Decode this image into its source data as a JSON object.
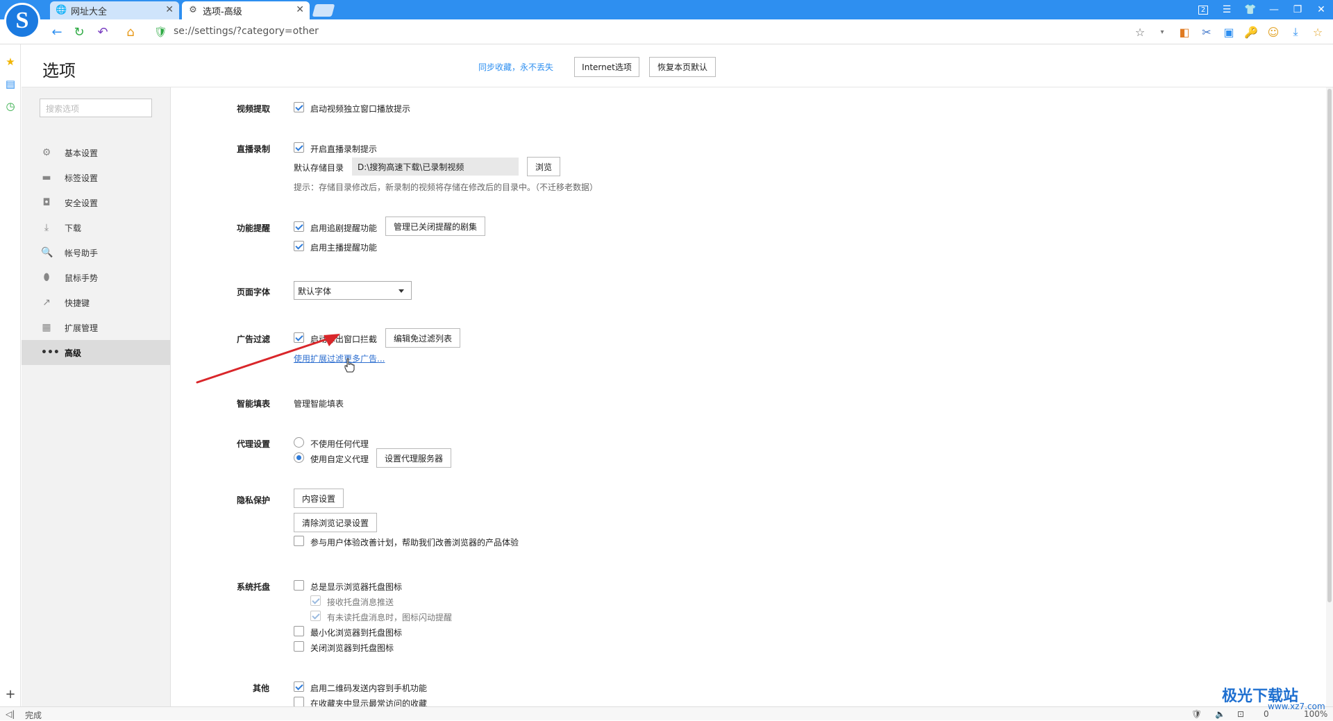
{
  "browser": {
    "tabs": [
      {
        "label": "网址大全",
        "icon": "globe-icon"
      },
      {
        "label": "选项-高级",
        "icon": "gear-icon"
      }
    ],
    "window_badge": "2",
    "url": "se://settings/?category=other",
    "status": "完成",
    "zoom": "100%",
    "status_count": "0"
  },
  "header": {
    "title": "选项",
    "sync_link": "同步收藏，永不丢失",
    "internet_options": "Internet选项",
    "restore_defaults": "恢复本页默认"
  },
  "sidebar": {
    "search_placeholder": "搜索选项",
    "items": [
      {
        "label": "基本设置",
        "icon": "gear-icon"
      },
      {
        "label": "标签设置",
        "icon": "tab-icon"
      },
      {
        "label": "安全设置",
        "icon": "shield-icon"
      },
      {
        "label": "下载",
        "icon": "download-icon"
      },
      {
        "label": "帐号助手",
        "icon": "key-icon"
      },
      {
        "label": "鼠标手势",
        "icon": "mouse-icon"
      },
      {
        "label": "快捷键",
        "icon": "shortcut-icon"
      },
      {
        "label": "扩展管理",
        "icon": "grid-icon"
      },
      {
        "label": "高级",
        "icon": "more-icon",
        "selected": true
      }
    ]
  },
  "sections": {
    "video": {
      "label": "视频提取",
      "opt1": "启动视频独立窗口播放提示"
    },
    "live": {
      "label": "直播录制",
      "opt1": "开启直播录制提示",
      "dir_label": "默认存储目录",
      "dir_value": "D:\\搜狗高速下载\\已录制视频",
      "browse": "浏览",
      "hint": "提示：存储目录修改后，新录制的视频将存储在修改后的目录中。（不迁移老数据）"
    },
    "reminder": {
      "label": "功能提醒",
      "opt1": "启用追剧提醒功能",
      "btn": "管理已关闭提醒的剧集",
      "opt2": "启用主播提醒功能"
    },
    "font": {
      "label": "页面字体",
      "value": "默认字体"
    },
    "adblock": {
      "label": "广告过滤",
      "opt1": "启动弹出窗口拦截",
      "btn": "编辑免过滤列表",
      "link": "使用扩展过滤更多广告..."
    },
    "autofill": {
      "label": "智能填表",
      "text": "管理智能填表"
    },
    "proxy": {
      "label": "代理设置",
      "opt1": "不使用任何代理",
      "opt2": "使用自定义代理",
      "btn": "设置代理服务器"
    },
    "privacy": {
      "label": "隐私保护",
      "btn1": "内容设置",
      "btn2": "清除浏览记录设置",
      "opt1": "参与用户体验改善计划，帮助我们改善浏览器的产品体验"
    },
    "tray": {
      "label": "系统托盘",
      "opt1": "总是显示浏览器托盘图标",
      "opt2": "接收托盘消息推送",
      "opt3": "有未读托盘消息时，图标闪动提醒",
      "opt4": "最小化浏览器到托盘图标",
      "opt5": "关闭浏览器到托盘图标"
    },
    "other": {
      "label": "其他",
      "opt1": "启用二维码发送内容到手机功能",
      "opt2": "在收藏夹中显示最常访问的收藏"
    }
  },
  "watermark": {
    "title": "极光下载站",
    "url": "www.xz7.com"
  },
  "colors": {
    "accent": "#2e8ff0",
    "link": "#2e6fd0",
    "checkbox": "#2e7bd9",
    "arrow": "#d9262a"
  }
}
